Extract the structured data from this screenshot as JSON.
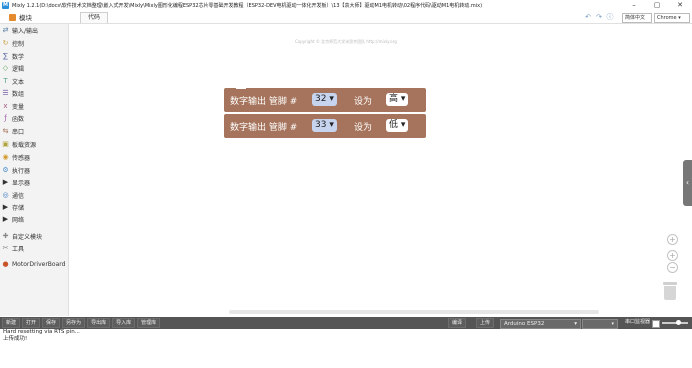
{
  "titlebar": {
    "logo": "M",
    "title": "Mixly 1.2.1(D:\\docs\\软件技术文档整理\\嵌入式开发\\Mixly\\Mixly图形化编程ESP32芯片零基础开发教程（ESP32-DEV电机驱动一体化开发板）\\13【袁大师】驱动M1电机转动\\02程序代码\\驱动M1电机转动.mix)",
    "minimize": "–",
    "maximize": "▢",
    "close": "✕"
  },
  "toolbar": {
    "modules_label": "模块",
    "code_tab": "代码",
    "language": "简体中文",
    "browser": "Chrome"
  },
  "sidebar": {
    "items": [
      {
        "label": "输入/输出",
        "icon": "io-icon",
        "color": "#5b80a5"
      },
      {
        "label": "控制",
        "icon": "control-icon",
        "color": "#c9a34a"
      },
      {
        "label": "数学",
        "icon": "math-icon",
        "color": "#5b67a5"
      },
      {
        "label": "逻辑",
        "icon": "logic-icon",
        "color": "#5ba55b"
      },
      {
        "label": "文本",
        "icon": "text-icon",
        "color": "#5ba58c"
      },
      {
        "label": "数组",
        "icon": "array-icon",
        "color": "#745ba5"
      },
      {
        "label": "变量",
        "icon": "variable-icon",
        "color": "#a55b80"
      },
      {
        "label": "函数",
        "icon": "function-icon",
        "color": "#995ba5"
      },
      {
        "label": "串口",
        "icon": "serial-icon",
        "color": "#a5745b"
      },
      {
        "label": "板载资源",
        "icon": "onboard-icon",
        "color": "#b0a33a"
      },
      {
        "label": "传感器",
        "icon": "sensor-icon",
        "color": "#d39a2b"
      },
      {
        "label": "执行器",
        "icon": "actuator-icon",
        "color": "#4a90c9"
      },
      {
        "label": "显示器",
        "icon": "display-icon",
        "color": "#333333"
      },
      {
        "label": "通信",
        "icon": "communication-icon",
        "color": "#3a7abf"
      },
      {
        "label": "存储",
        "icon": "storage-icon",
        "color": "#333333"
      },
      {
        "label": "网络",
        "icon": "network-icon",
        "color": "#333333"
      },
      {
        "label": "自定义模块",
        "icon": "custom-module-icon",
        "color": "#888888"
      },
      {
        "label": "工具",
        "icon": "tools-icon",
        "color": "#888888"
      },
      {
        "label": "MotorDriverBoard",
        "icon": "motor-board-icon",
        "color": "#c9532b"
      }
    ]
  },
  "canvas": {
    "copyright": "Copyright © 北京师范大学米思齐团队 http://mixly.org",
    "blocks": [
      {
        "text": "数字输出 管脚 #",
        "pin": "32",
        "set_label": "设为",
        "level": "高"
      },
      {
        "text": "数字输出 管脚 #",
        "pin": "33",
        "set_label": "设为",
        "level": "低"
      }
    ],
    "zoom_reset": "+",
    "zoom_in": "+",
    "zoom_out": "−",
    "colors": {
      "block": "#a6745c",
      "dropdown": "#c6d4ef"
    }
  },
  "statusbar": {
    "buttons": [
      "新建",
      "打开",
      "保存",
      "另存为",
      "导出库",
      "导入库",
      "管理库"
    ],
    "compile": "编译",
    "upload": "上传",
    "board": "Arduino ESP32",
    "serial_monitor": "串口监视器"
  },
  "console": {
    "lines": [
      "Hard resetting via RTS pin...",
      "上传成功!"
    ]
  }
}
